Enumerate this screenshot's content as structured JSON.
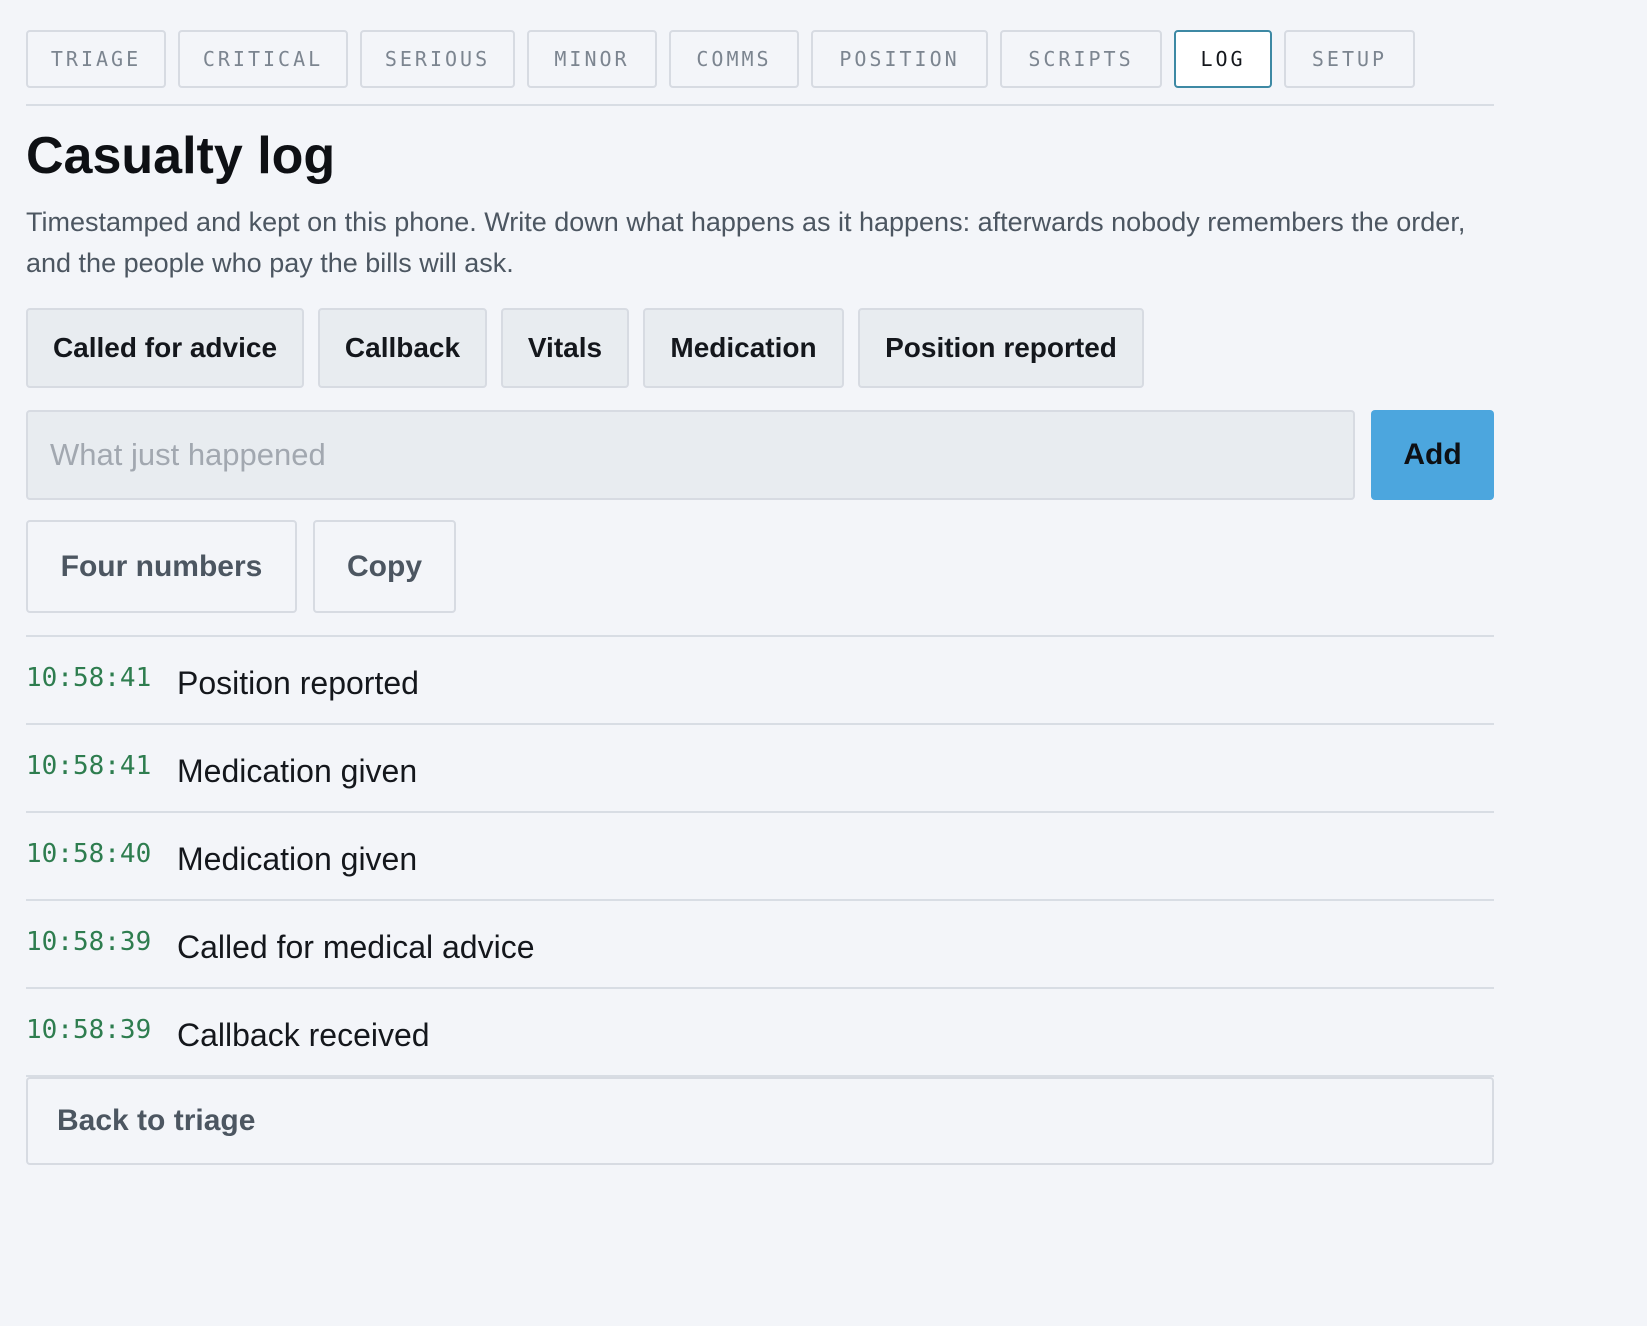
{
  "tabs": [
    {
      "label": "TRIAGE",
      "active": false
    },
    {
      "label": "CRITICAL",
      "active": false
    },
    {
      "label": "SERIOUS",
      "active": false
    },
    {
      "label": "MINOR",
      "active": false
    },
    {
      "label": "COMMS",
      "active": false
    },
    {
      "label": "POSITION",
      "active": false
    },
    {
      "label": "SCRIPTS",
      "active": false
    },
    {
      "label": "LOG",
      "active": true
    },
    {
      "label": "SETUP",
      "active": false
    }
  ],
  "page": {
    "title": "Casualty log",
    "intro": "Timestamped and kept on this phone. Write down what happens as it happens: afterwards nobody remembers the order, and the people who pay the bills will ask."
  },
  "quick_entries": [
    {
      "label": "Called for advice"
    },
    {
      "label": "Callback"
    },
    {
      "label": "Vitals"
    },
    {
      "label": "Medication"
    },
    {
      "label": "Position reported"
    }
  ],
  "entry": {
    "placeholder": "What just happened",
    "value": "",
    "add_label": "Add"
  },
  "tools": {
    "four_numbers_label": "Four numbers",
    "copy_label": "Copy"
  },
  "log_entries": [
    {
      "time": "10:58:41",
      "text": "Position reported"
    },
    {
      "time": "10:58:41",
      "text": "Medication given"
    },
    {
      "time": "10:58:40",
      "text": "Medication given"
    },
    {
      "time": "10:58:39",
      "text": "Called for medical advice"
    },
    {
      "time": "10:58:39",
      "text": "Callback received"
    }
  ],
  "footer": {
    "back_label": "Back to triage"
  },
  "colors": {
    "background": "#f3f5f9",
    "accent": "#4ca6de",
    "active_tab_border": "#3d89a4",
    "timestamp": "#2e7d4f"
  }
}
